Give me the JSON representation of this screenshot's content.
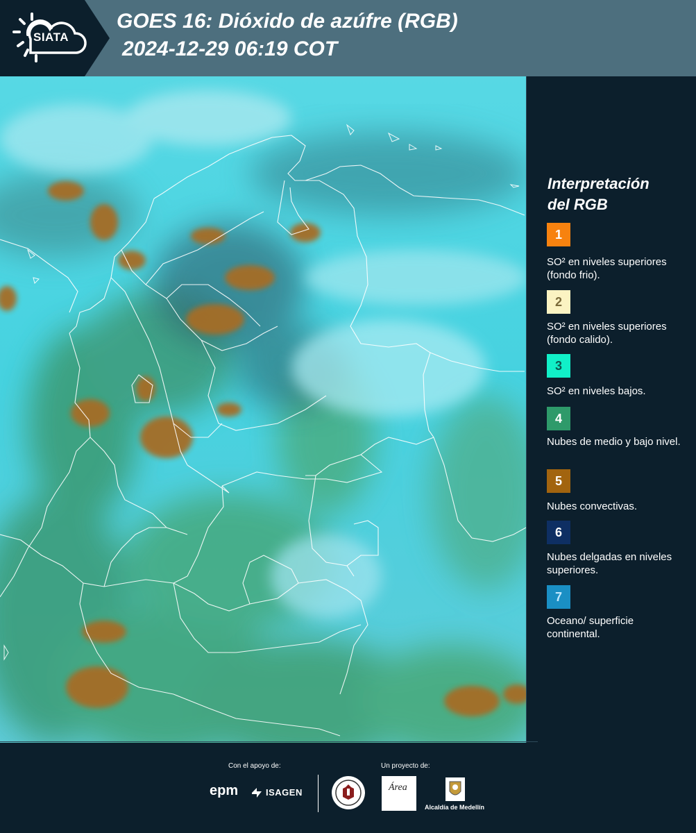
{
  "header": {
    "logo_text": "SIATA",
    "title_line1": "GOES 16: Dióxido de azúfre (RGB)",
    "title_line2": "2024-12-29 06:19 COT"
  },
  "legend": {
    "title_line1": "Interpretación",
    "title_line2": "del RGB",
    "items": [
      {
        "number": "1",
        "color": "#f7820f",
        "text_color": "#ffffff",
        "label": "SO² en niveles superiores (fondo frio)."
      },
      {
        "number": "2",
        "color": "#fbf3c2",
        "text_color": "#7a6a3a",
        "label": "SO² en niveles superiores (fondo calido)."
      },
      {
        "number": "3",
        "color": "#11f0c8",
        "text_color": "#0b5a52",
        "label": "SO² en niveles bajos."
      },
      {
        "number": "4",
        "color": "#2e9a6a",
        "text_color": "#ffffff",
        "label": "Nubes de medio y bajo nivel."
      },
      {
        "number": "5",
        "color": "#a2640f",
        "text_color": "#ffffff",
        "label": "Nubes convectivas."
      },
      {
        "number": "6",
        "color": "#0e2f63",
        "text_color": "#ffffff",
        "label": "Nubes delgadas en niveles superiores."
      },
      {
        "number": "7",
        "color": "#1a8fc4",
        "text_color": "#bfe8ff",
        "label": "Oceano/ superficie continental."
      }
    ]
  },
  "footer": {
    "support_label": "Con el apoyo de:",
    "project_label": "Un proyecto de:",
    "epm": "epm",
    "isagen": "ISAGEN",
    "area": "Área",
    "alcaldia": "Alcaldía de Medellín"
  }
}
